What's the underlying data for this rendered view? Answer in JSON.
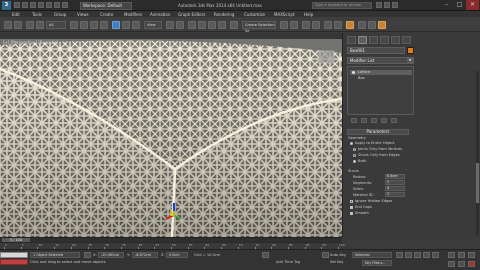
{
  "titlebar": {
    "workspace": "Workspace: Default",
    "app_title": "Autodesk 3ds Max 2014 x64    Untitled.max",
    "search_placeholder": "Type a keyword or phrase"
  },
  "menu": {
    "items": [
      "Edit",
      "Tools",
      "Group",
      "Views",
      "Create",
      "Modifiers",
      "Animation",
      "Graph Editors",
      "Rendering",
      "Customize",
      "MAXScript",
      "Help"
    ]
  },
  "toolbar": {
    "selection_filter": "All",
    "ref_coord": "View",
    "named_selection": "Create Selection Se"
  },
  "viewport": {
    "label": "[+] [Perspective] [Realistic]"
  },
  "command_panel": {
    "object_name": "Box001",
    "object_color": "#e27d12",
    "modifier_list": "Modifier List",
    "stack": [
      {
        "label": "Lattice",
        "selected": true
      },
      {
        "label": "Box",
        "selected": false
      }
    ],
    "parameters_title": "Parameters",
    "geometry_label": "Geometry",
    "geometry_options": [
      {
        "label": "Apply to Entire Object",
        "checked": true
      },
      {
        "label": "Joints Only from Vertices",
        "checked": false
      },
      {
        "label": "Struts Only from Edges",
        "checked": false
      },
      {
        "label": "Both",
        "checked": false
      }
    ],
    "struts_label": "Struts",
    "struts": {
      "radius_label": "Radius:",
      "radius_value": "0.5cm",
      "segments_label": "Segments:",
      "segments_value": "1",
      "sides_label": "Sides:",
      "sides_value": "4",
      "material_label": "Material ID:",
      "material_value": "1"
    },
    "ignore_hidden": "Ignore Hidden Edges",
    "end_caps": "End Caps",
    "smooth": "Smooth"
  },
  "timeline": {
    "slider_label": "0 / 100",
    "ticks": [
      "0",
      "5",
      "10",
      "15",
      "20",
      "25",
      "30",
      "35",
      "40",
      "45",
      "50",
      "55",
      "60",
      "65",
      "70",
      "75",
      "80",
      "85",
      "90",
      "95",
      "100"
    ]
  },
  "status": {
    "selected": "1 Object Selected",
    "prompt": "Click and drag to select and move objects",
    "x_label": "X:",
    "x_value": "-20.981cm",
    "y_label": "Y:",
    "y_value": "-8.872cm",
    "z_label": "Z:",
    "z_value": "0.0cm",
    "grid": "Grid = 10.0cm",
    "add_time_tag": "Add Time Tag",
    "auto_key": "Auto Key",
    "selected_dropdown": "Selected",
    "set_key": "Set Key",
    "key_filters": "Key Filters..."
  }
}
